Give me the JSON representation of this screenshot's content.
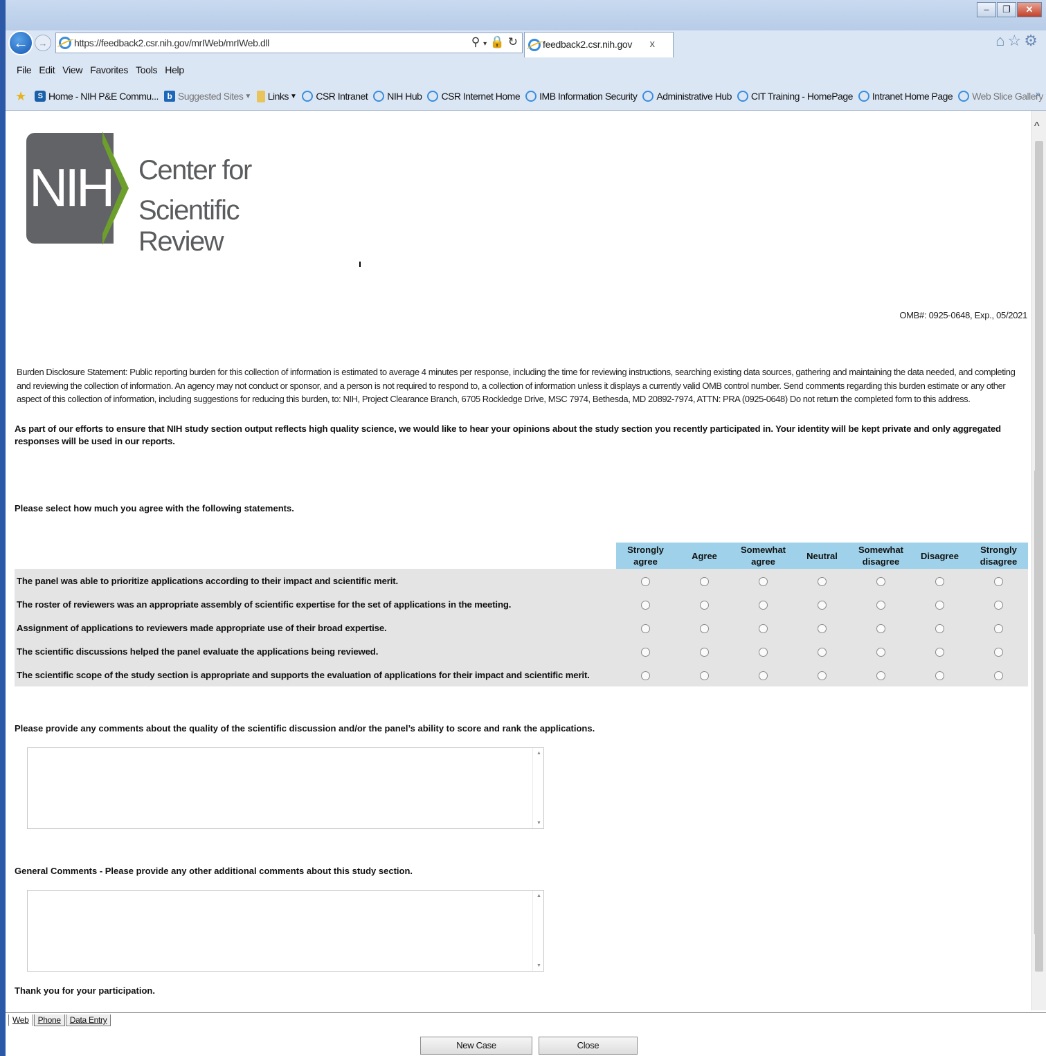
{
  "browser": {
    "url": "https://feedback2.csr.nih.gov/mrIWeb/mrIWeb.dll",
    "tab_title": "feedback2.csr.nih.gov",
    "tab_close": "x",
    "menu": [
      "File",
      "Edit",
      "View",
      "Favorites",
      "Tools",
      "Help"
    ],
    "favorites": [
      {
        "label": "Home - NIH P&E Commu...",
        "icon": "sharepoint-icon"
      },
      {
        "label": "Suggested Sites",
        "icon": "bing-icon",
        "dropdown": true
      },
      {
        "label": "Links",
        "icon": "folder-icon",
        "dropdown": true
      },
      {
        "label": "CSR Intranet",
        "icon": "ie-icon"
      },
      {
        "label": "NIH Hub",
        "icon": "ie-icon"
      },
      {
        "label": "CSR Internet Home",
        "icon": "ie-icon"
      },
      {
        "label": "IMB Information Security",
        "icon": "ie-icon"
      },
      {
        "label": "Administrative Hub",
        "icon": "ie-icon"
      },
      {
        "label": "CIT Training - HomePage",
        "icon": "ie-icon"
      },
      {
        "label": "Intranet Home Page",
        "icon": "ie-icon"
      },
      {
        "label": "Web Slice Gallery",
        "icon": "ie-icon",
        "dropdown": true
      }
    ]
  },
  "header": {
    "logo_abbrev": "NIH",
    "logo_line1": "Center for",
    "logo_line2": "Scientific Review",
    "omb": "OMB#: 0925-0648, Exp., 05/2021",
    "burden": "Burden Disclosure Statement: Public reporting burden for this collection of information is estimated to average 4 minutes per response, including the time for reviewing instructions, searching existing data sources, gathering and maintaining the data needed, and completing and reviewing the collection of information. An agency may not conduct or sponsor, and a person is not required to respond to, a collection of information unless it displays a currently valid OMB control number. Send comments regarding this burden estimate or any other aspect of this collection of information, including suggestions for reducing this burden, to: NIH, Project Clearance Branch, 6705 Rockledge Drive, MSC 7974, Bethesda, MD 20892-7974, ATTN: PRA (0925-0648) Do not return the completed form to this address.",
    "colors": {
      "logo_gray": "#626366",
      "logo_green": "#6d9f2d"
    }
  },
  "survey": {
    "intro": "As part of our efforts to ensure that NIH study section output reflects high quality science, we would like to hear your opinions about the study section you recently participated in. Your identity will be kept private and only aggregated responses will be used in our reports.",
    "instruction": "Please select how much you agree with the following statements.",
    "scale": [
      "Strongly agree",
      "Agree",
      "Somewhat agree",
      "Neutral",
      "Somewhat disagree",
      "Disagree",
      "Strongly disagree"
    ],
    "statements": [
      "The panel was able to prioritize applications according to their impact and scientific merit.",
      "The roster of reviewers was an appropriate assembly of scientific expertise for the set of applications in the meeting.",
      "Assignment of applications to reviewers made appropriate use of their broad expertise.",
      "The scientific discussions helped the panel evaluate the applications being reviewed.",
      "The scientific scope of the study section is appropriate and supports the evaluation of applications for their impact and scientific merit."
    ],
    "comments_label": "Please provide any comments about the quality of the scientific discussion and/or the panel’s ability to score and rank the applications.",
    "comments_value": "",
    "general_label": "General Comments - Please provide any other additional comments about this study section.",
    "general_value": "",
    "thanks": "Thank you for your participation.",
    "colors": {
      "header_bg": "#9fd2ea",
      "row_bg": "#e4e4e4"
    }
  },
  "footer": {
    "tabs": [
      "Web",
      "Phone",
      "Data Entry"
    ],
    "new_case": "New Case",
    "close": "Close"
  }
}
